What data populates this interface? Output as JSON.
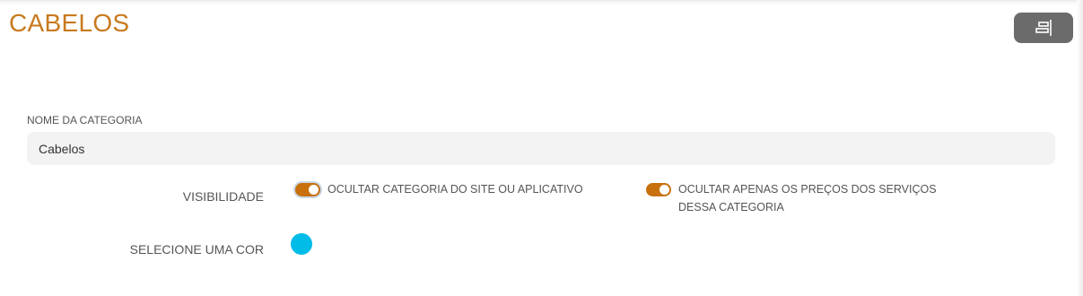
{
  "header": {
    "title": "CABELOS",
    "title_color": "#c87a1e",
    "action_button": {
      "icon": "align-right-icon",
      "color": "#6b6b6b"
    }
  },
  "form": {
    "category_name": {
      "label": "NOME DA CATEGORIA",
      "value": "Cabelos"
    },
    "visibility": {
      "label": "VISIBILIDADE",
      "options": [
        {
          "label": "OCULTAR CATEGORIA DO SITE OU APLICATIVO",
          "enabled": true
        },
        {
          "label": "OCULTAR APENAS OS PREÇOS DOS SERVIÇOS DESSA CATEGORIA",
          "enabled": true
        }
      ],
      "toggle_color": "#c8700e"
    },
    "color": {
      "label": "SELECIONE UMA COR",
      "selected": "#00bce7"
    }
  }
}
